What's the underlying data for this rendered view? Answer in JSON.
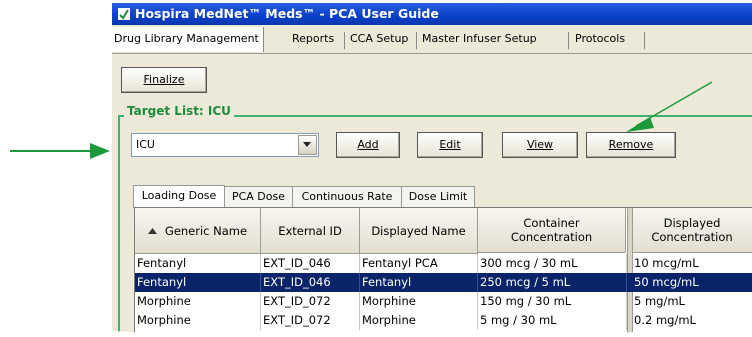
{
  "window": {
    "title": "Hospira MedNet™ Meds™ - PCA User Guide"
  },
  "main_tabs": [
    {
      "label": "Drug Library Management"
    },
    {
      "label": "Reports"
    },
    {
      "label": "CCA Setup"
    },
    {
      "label": "Master Infuser Setup"
    },
    {
      "label": "Protocols"
    }
  ],
  "toolbar": {
    "finalize_label": "Finalize"
  },
  "target_list": {
    "title": "Target List: ICU",
    "selected_value": "ICU",
    "add_label": "Add",
    "edit_label": "Edit",
    "view_label": "View",
    "remove_label": "Remove"
  },
  "sub_tabs": [
    {
      "label": "Loading Dose"
    },
    {
      "label": "PCA Dose"
    },
    {
      "label": "Continuous Rate"
    },
    {
      "label": "Dose Limit"
    }
  ],
  "table": {
    "columns": [
      "Generic Name",
      "External ID",
      "Displayed Name",
      "Container Concentration",
      "Displayed Concentration"
    ],
    "rows": [
      [
        "Fentanyl",
        "EXT_ID_046",
        "Fentanyl PCA",
        "300 mcg / 30 mL",
        "10 mcg/mL"
      ],
      [
        "Fentanyl",
        "EXT_ID_046",
        "Fentanyl",
        "250 mcg / 5 mL",
        "50 mcg/mL"
      ],
      [
        "Morphine",
        "EXT_ID_072",
        "Morphine",
        "150 mg / 30 mL",
        "5 mg/mL"
      ],
      [
        "Morphine",
        "EXT_ID_072",
        "Morphine",
        "5 mg / 30 mL",
        "0.2 mg/mL"
      ]
    ],
    "selected_row": 1
  },
  "colors": {
    "annotation_arrow": "#1a9a3a",
    "selection": "#0a246a",
    "titlebar": "#0a3fc8"
  }
}
